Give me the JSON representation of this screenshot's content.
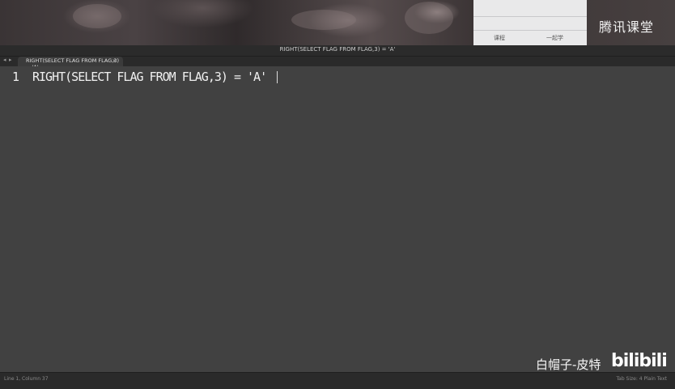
{
  "window": {
    "title": "RIGHT(SELECT FLAG FROM FLAG,3) = 'A'"
  },
  "tabs": [
    {
      "label": "RIGHT(SELECT FLAG FROM FLAG,3) = 'A'",
      "close": "×"
    }
  ],
  "nav": {
    "back": "◂",
    "forward": "▸"
  },
  "editor": {
    "lines": [
      {
        "number": "1",
        "text": "RIGHT(SELECT FLAG FROM FLAG,3) = 'A'"
      }
    ]
  },
  "overlay": {
    "logo": "腾讯课堂",
    "watermark_text": "白帽子-皮特",
    "watermark_brand": "bilibili",
    "popup_tabs": [
      "课程",
      "一起学"
    ]
  },
  "statusbar": {
    "left": "Line 1, Column 37",
    "right": "Tab Size: 4    Plain Text"
  }
}
